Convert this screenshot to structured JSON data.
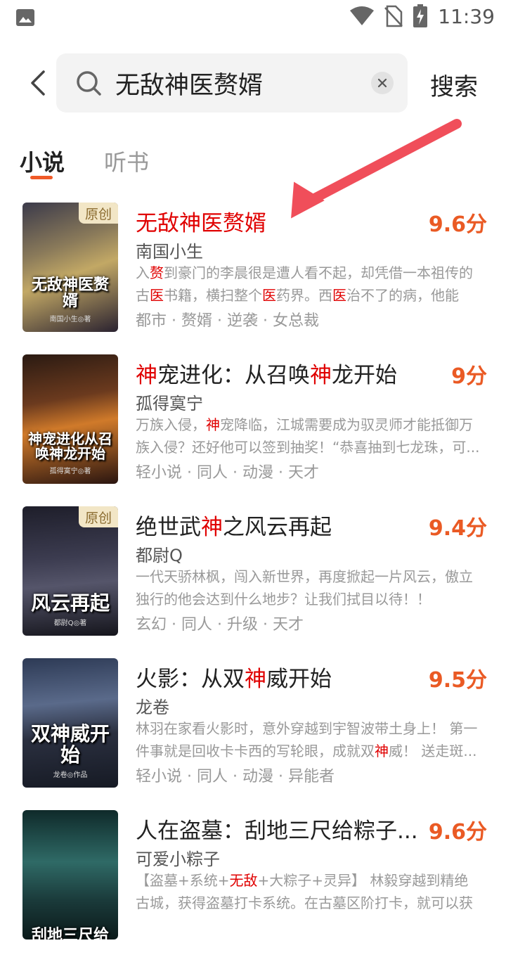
{
  "status_bar": {
    "time": "11:39",
    "icons": [
      "gallery-icon",
      "wifi-icon",
      "no-sim-icon",
      "battery-charging-icon"
    ]
  },
  "search": {
    "query": "无敌神医赘婿",
    "submit_label": "搜索"
  },
  "tabs": [
    {
      "label": "小说",
      "active": true
    },
    {
      "label": "听书",
      "active": false
    }
  ],
  "books": [
    {
      "title": "无敌神医赘婿",
      "author": "南国小生",
      "rating": "9.6分",
      "badge": "原创",
      "cover_text": "无敌神医赘婿",
      "cover_author": "南国小生◎著",
      "desc_parts": [
        "入",
        "赘",
        "到豪门的李晨很是遭人看不起，却凭借一本祖传的古",
        "医",
        "书籍，横扫整个",
        "医",
        "药界。西",
        "医",
        "治不了的病，他能治..."
      ],
      "tags": "都市 · 赘婿 · 逆袭 · 女总裁"
    },
    {
      "title_parts": [
        "神",
        "宠进化：从召唤",
        "神",
        "龙开始"
      ],
      "author": "孤得寞宁",
      "rating": "9分",
      "cover_text": "神宠进化从召唤神龙开始",
      "cover_author": "孤得寞宁◎著",
      "desc_parts": [
        "万族入侵，",
        "神",
        "宠降临，江城需要成为驭灵师才能抵御万族入侵？还好他可以签到抽奖！“恭喜抽到七龙珠，可..."
      ],
      "tags": "轻小说 · 同人 · 动漫 · 天才"
    },
    {
      "title_parts": [
        "绝世武",
        "神",
        "之风云再起"
      ],
      "author": "都尉Q",
      "rating": "9.4分",
      "badge": "原创",
      "cover_text": "风云再起",
      "cover_author": "都尉Q◎著",
      "desc": "一代天骄林枫，闯入新世界，再度掀起一片风云，傲立独行的他会达到什么地步？让我们拭目以待！！",
      "tags": "玄幻 · 同人 · 升级 · 天才"
    },
    {
      "title_parts": [
        "火影：从双",
        "神",
        "威开始"
      ],
      "author": "龙卷",
      "rating": "9.5分",
      "cover_text": "双神威开始",
      "cover_author": "龙卷◎作品",
      "desc_parts": [
        "林羽在家看火影时，意外穿越到宇智波带土身上！ 第一件事就是回收卡卡西的写轮眼，成就双",
        "神",
        "威！ 送走斑..."
      ],
      "tags": "轻小说 · 同人 · 动漫 · 异能者"
    },
    {
      "title": "人在盗墓：刮地三尺给粽子...",
      "author": "可爱小粽子",
      "rating": "9.6分",
      "cover_text": "刮地三尺给",
      "desc_parts": [
        "【盗墓+系统+",
        "无敌",
        "+大粽子+灵异】 林毅穿越到精绝古城，获得盗墓打卡系统。在古墓区阶打卡，就可以获得..."
      ],
      "tags": ""
    }
  ],
  "colors": {
    "accent": "#ea5a24",
    "highlight": "#e00000",
    "annotation_arrow": "#f04e5a"
  }
}
